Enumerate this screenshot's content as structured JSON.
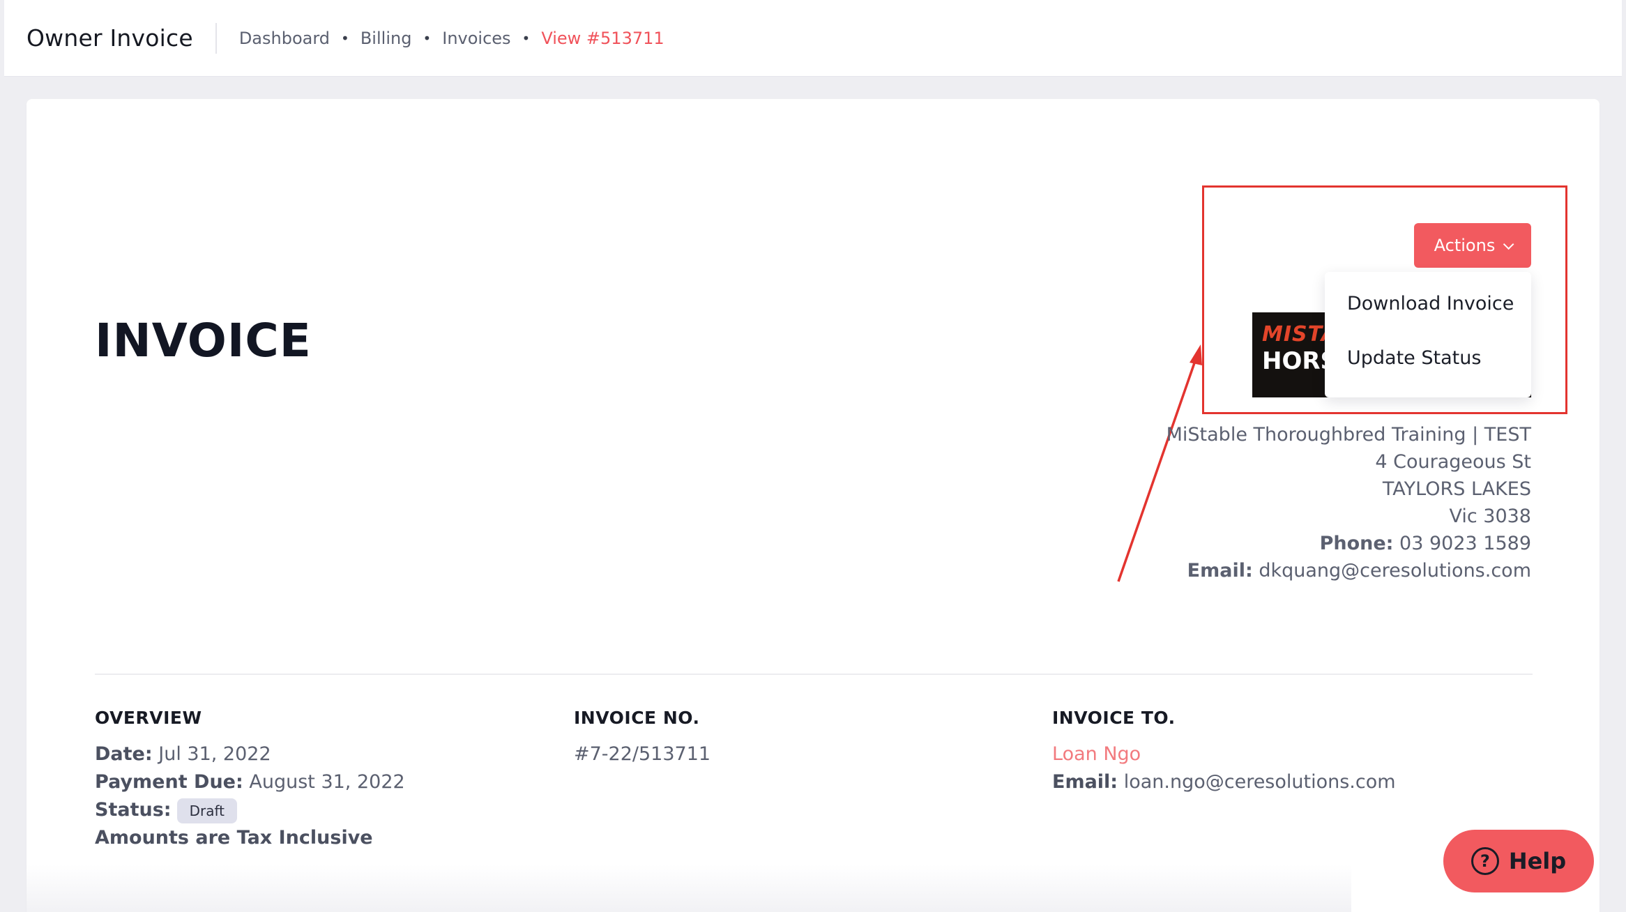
{
  "header": {
    "title": "Owner Invoice",
    "breadcrumb": [
      "Dashboard",
      "Billing",
      "Invoices"
    ],
    "breadcrumb_active": "View #513711"
  },
  "invoice": {
    "heading": "INVOICE"
  },
  "actions": {
    "label": "Actions",
    "menu": [
      "Download Invoice",
      "Update Status"
    ]
  },
  "logo": {
    "line1": "MISTA",
    "line2": "HORSE"
  },
  "company": {
    "name": "MiStable Thoroughbred Training | TEST",
    "address1": "4 Courageous St",
    "city": "TAYLORS LAKES",
    "state": "Vic 3038",
    "phone_label": "Phone:",
    "phone": "03 9023 1589",
    "email_label": "Email:",
    "email": "dkquang@ceresolutions.com"
  },
  "overview": {
    "heading": "OVERVIEW",
    "date_label": "Date:",
    "date": "Jul 31, 2022",
    "due_label": "Payment Due:",
    "due": "August 31, 2022",
    "status_label": "Status:",
    "status": "Draft",
    "tax_note": "Amounts are Tax Inclusive"
  },
  "invoice_no": {
    "heading": "INVOICE NO.",
    "value": "#7-22/513711"
  },
  "invoice_to": {
    "heading": "INVOICE TO.",
    "name": "Loan Ngo",
    "email_label": "Email:",
    "email": "loan.ngo@ceresolutions.com"
  },
  "help": {
    "label": "Help"
  },
  "colors": {
    "accent": "#f25a5f",
    "annotation": "#e3342f",
    "link": "#f27a7e"
  }
}
